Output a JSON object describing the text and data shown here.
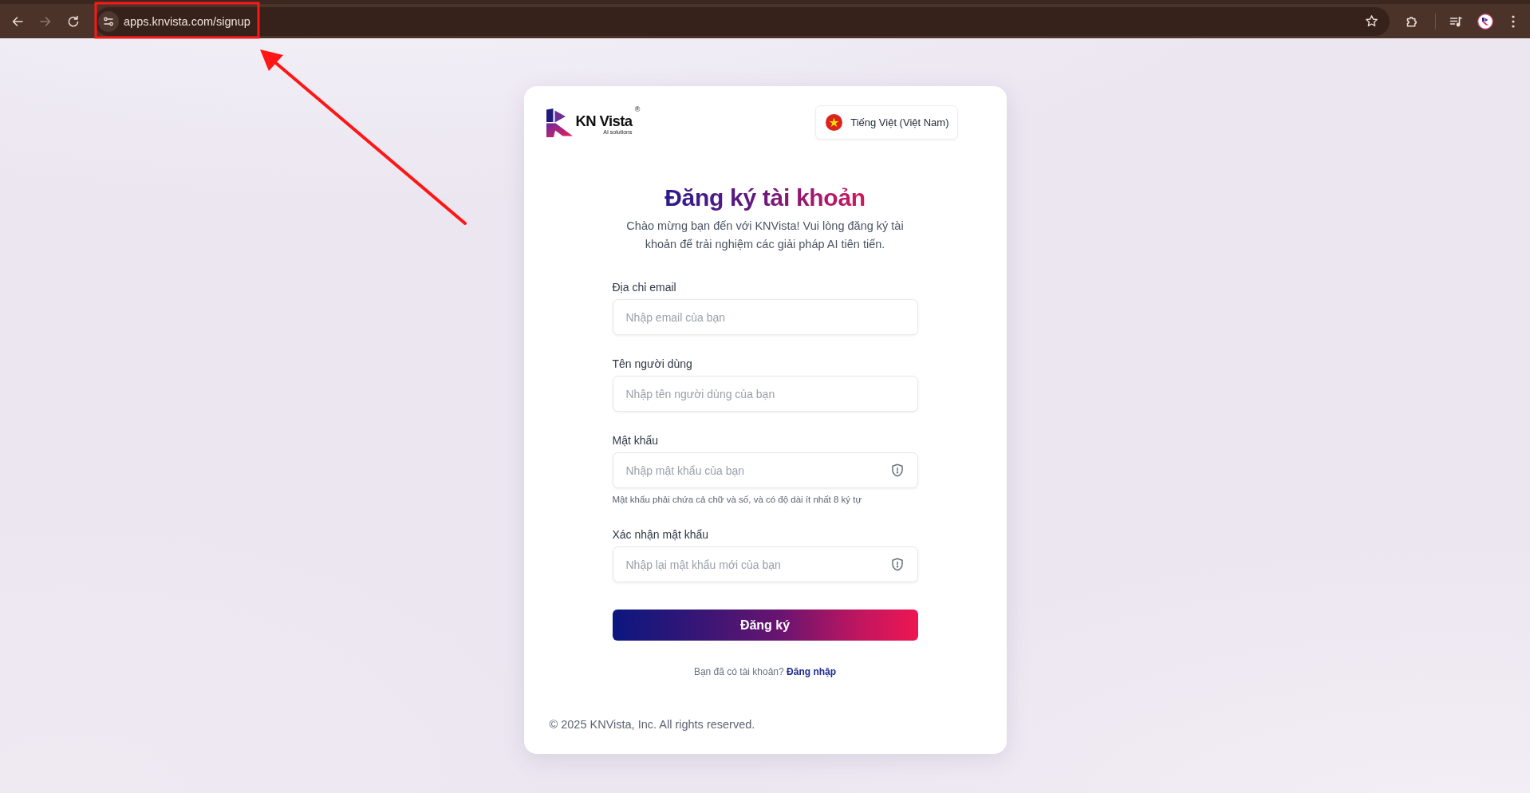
{
  "browser": {
    "back_button": {
      "disabled": false
    },
    "forward_button": {
      "disabled": true
    },
    "url": "apps.knvista.com/signup"
  },
  "header": {
    "logo": {
      "wordmark": "KN Vista",
      "registered_mark": "®",
      "tagline": "AI solutions"
    },
    "language_button": {
      "label": "Tiếng Việt (Việt Nam)"
    }
  },
  "title": "Đăng ký tài khoản",
  "subtitle": "Chào mừng bạn đến với KNVista! Vui lòng đăng ký tài khoản để trải nghiệm các giải pháp AI tiên tiến.",
  "fields": [
    {
      "kind": "email",
      "label": "Địa chỉ email",
      "placeholder": "Nhập email của bạn"
    },
    {
      "kind": "text",
      "label": "Tên người dùng",
      "placeholder": "Nhập tên người dùng của bạn"
    },
    {
      "kind": "password",
      "label": "Mật khẩu",
      "placeholder": "Nhập mật khẩu của bạn",
      "hint": "Mật khẩu phải chứa cả chữ và số, và có độ dài ít nhất 8 ký tự"
    },
    {
      "kind": "password",
      "label": "Xác nhận mật khẩu",
      "placeholder": "Nhập lại mật khẩu mới của bạn"
    }
  ],
  "submit_button": {
    "label": "Đăng ký"
  },
  "signin_prompt": {
    "text": "Bạn đã có tài khoản?",
    "link": "Đăng nhập"
  },
  "footer": "© 2025 KNVista, Inc. All rights reserved."
}
